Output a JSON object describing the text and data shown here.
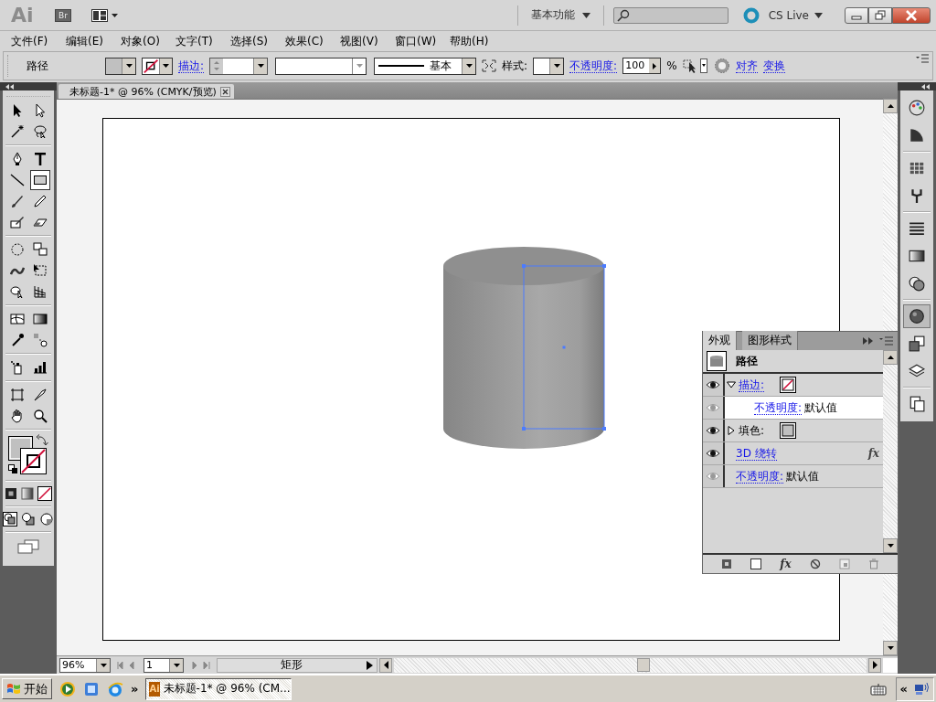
{
  "app_bar": {
    "logo": "Ai",
    "bridge": "Br",
    "workspace": "基本功能",
    "cs_live": "CS Live"
  },
  "menu": [
    "文件(F)",
    "编辑(E)",
    "对象(O)",
    "文字(T)",
    "选择(S)",
    "效果(C)",
    "视图(V)",
    "窗口(W)",
    "帮助(H)"
  ],
  "control_bar": {
    "object_type": "路径",
    "stroke_link": "描边:",
    "stroke_profile": "基本",
    "style_label": "样式:",
    "opacity_link": "不透明度:",
    "opacity_value": "100",
    "percent": "%",
    "align_link": "对齐",
    "transform_link": "变换"
  },
  "document_tab": {
    "title": "未标题-1* @ 96% (CMYK/预览)"
  },
  "tool_groups": [
    {
      "tools": [
        {
          "selected": false
        },
        {
          "selected": false
        },
        {
          "selected": false
        },
        {
          "selected": false
        }
      ]
    },
    {
      "tools": [
        {
          "selected": false
        },
        {
          "selected": false
        },
        {
          "selected": false
        },
        {
          "selected": true
        },
        {
          "selected": false
        },
        {
          "selected": false
        },
        {
          "selected": false
        },
        {
          "selected": false
        }
      ]
    },
    {
      "tools": [
        {
          "selected": false
        },
        {
          "selected": false
        },
        {
          "selected": false
        },
        {
          "selected": false
        },
        {
          "selected": false
        },
        {
          "selected": false
        }
      ]
    },
    {
      "tools": [
        {
          "selected": false
        },
        {
          "selected": false
        },
        {
          "selected": false
        },
        {
          "selected": false
        }
      ]
    },
    {
      "tools": [
        {
          "selected": false
        },
        {
          "selected": false
        }
      ]
    },
    {
      "tools": [
        {
          "selected": false
        },
        {
          "selected": false
        },
        {
          "selected": false
        },
        {
          "selected": false
        }
      ]
    }
  ],
  "right_dock": [
    {
      "selected": false
    },
    {
      "selected": false
    },
    {
      "selected": false
    },
    {
      "selected": false
    },
    {
      "selected": false
    },
    {
      "selected": false
    },
    {
      "selected": false
    },
    {
      "selected": true
    },
    {
      "selected": false
    },
    {
      "selected": false
    },
    {
      "selected": false
    }
  ],
  "appearance_panel": {
    "tabs": [
      {
        "label": "外观",
        "selected": true
      },
      {
        "label": "图形样式",
        "selected": false
      }
    ],
    "object": "路径",
    "footer_fx": "fx",
    "rows": [
      {
        "kind": "stroke",
        "label": "描边:",
        "expanded": true,
        "selected": false,
        "children": [
          {
            "kind": "opacity",
            "label": "不透明度:",
            "value": "默认值",
            "selected": true
          }
        ]
      },
      {
        "kind": "fill",
        "label": "填色:",
        "expanded": false,
        "selected": false
      },
      {
        "kind": "effect",
        "label": "3D 绕转",
        "badge": "fx",
        "selected": false
      },
      {
        "kind": "opacity",
        "label": "不透明度:",
        "value": "默认值",
        "selected": false
      }
    ]
  },
  "status_bar": {
    "zoom": "96%",
    "page": "1",
    "info": "矩形"
  },
  "taskbar": {
    "start": "开始",
    "more": "»",
    "task_icon": "Ai",
    "task": "未标题-1* @ 96% (CM...",
    "tray_expand": "«"
  }
}
